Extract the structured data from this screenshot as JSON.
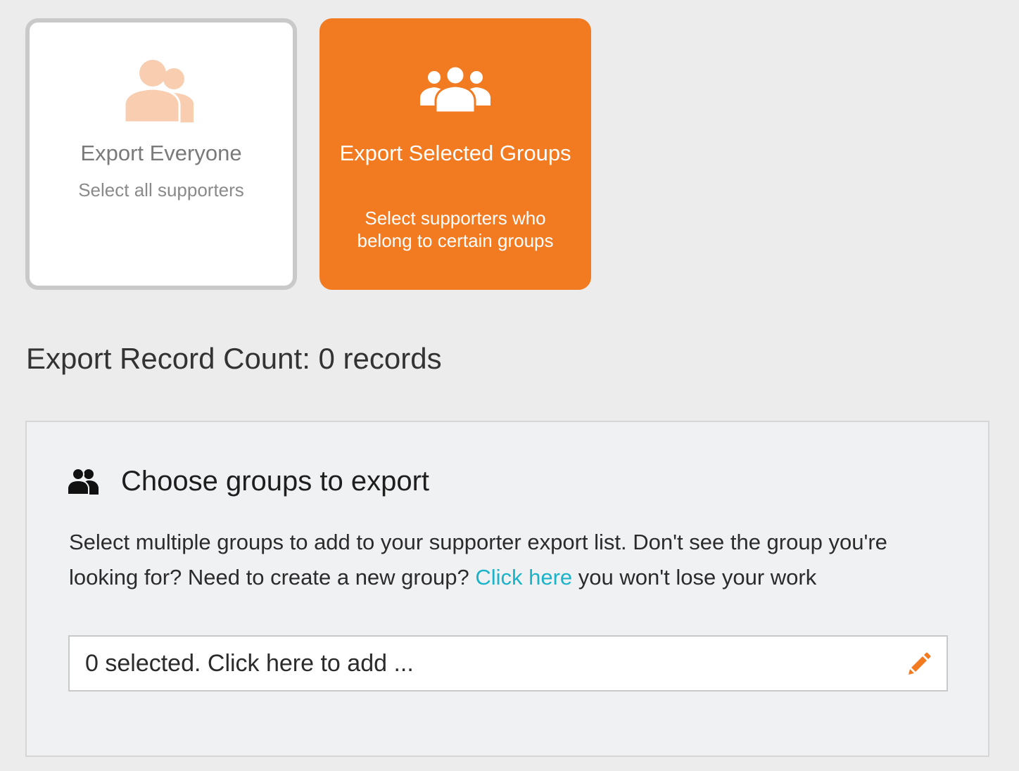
{
  "export_options": {
    "everyone": {
      "title": "Export Everyone",
      "subtitle": "Select all supporters",
      "icon": "users-icon",
      "icon_color": "#f8cdb0"
    },
    "selected_groups": {
      "title": "Export Selected Groups",
      "subtitle": "Select supporters who belong to certain groups",
      "icon": "group-icon",
      "active": true,
      "color": "#f27a21"
    }
  },
  "record_count": {
    "label": "Export Record Count: 0 records"
  },
  "groups_panel": {
    "title": "Choose groups to export",
    "icon": "users-icon",
    "description_before": "Select multiple groups to add to your supporter export list. Don't see the group you're looking for? Need to create a new group?",
    "link_text": "Click here",
    "description_after": "you won't lose your work",
    "link_color": "#1bb3c9",
    "selector": {
      "text": "0 selected. Click here to add ...",
      "icon": "pencil-icon",
      "icon_color": "#f27a21"
    }
  }
}
